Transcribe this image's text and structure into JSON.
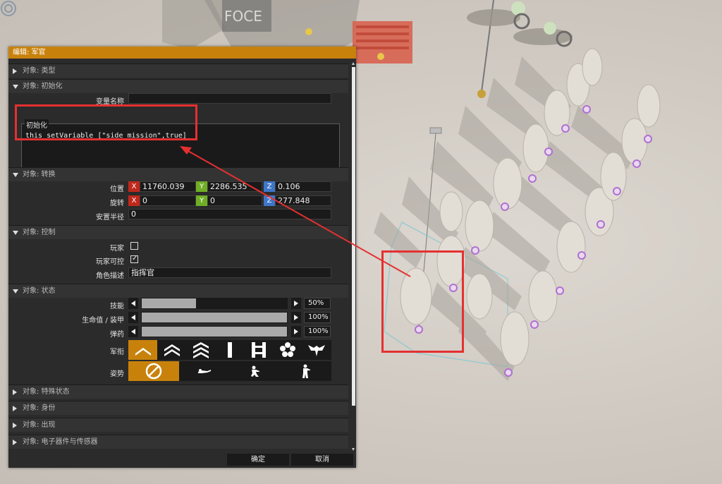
{
  "dialog": {
    "title": "编辑: 军官",
    "ok_label": "确定",
    "cancel_label": "取消"
  },
  "sections": {
    "type": "对象: 类型",
    "init": "对象: 初始化",
    "transform": "对象: 转换",
    "control": "对象: 控制",
    "state": "对象: 状态",
    "special": "对象: 特殊状态",
    "identity": "对象: 身份",
    "appearance": "对象: 出现",
    "electronics": "对象: 电子器件与传感器"
  },
  "init": {
    "var_name_label": "变量名称",
    "var_name_value": "",
    "init_label": "初始化",
    "init_code": "this setVariable [\"side_mission\",true]"
  },
  "transform": {
    "position_label": "位置",
    "rotation_label": "旋转",
    "radius_label": "安置半径",
    "axis_x": "X",
    "axis_y": "Y",
    "axis_z": "Z",
    "pos_x": "11760.039",
    "pos_y": "2286.535",
    "pos_z": "0.106",
    "rot_x": "0",
    "rot_y": "0",
    "rot_z": "277.848",
    "radius": "0"
  },
  "control": {
    "player_label": "玩家",
    "player_checked": false,
    "playable_label": "玩家可控",
    "playable_checked": true,
    "role_label": "角色描述",
    "role_value": "指挥官"
  },
  "state": {
    "skill_label": "技能",
    "skill_value": "50%",
    "skill_fraction": 0.5,
    "health_label": "生命值 / 装甲",
    "health_value": "100%",
    "health_fraction": 1.0,
    "ammo_label": "弹药",
    "ammo_value": "100%",
    "ammo_fraction": 1.0,
    "rank_label": "军衔",
    "ranks": [
      "private-chevron-icon",
      "corporal-icon",
      "sergeant-icon",
      "lieutenant-icon",
      "captain-icon",
      "major-icon",
      "colonel-icon"
    ],
    "rank_selected": 0,
    "stance_label": "姿势",
    "stances": [
      "no-stance-icon",
      "prone-icon",
      "crouch-icon",
      "stand-icon"
    ],
    "stance_selected": 0
  },
  "colors": {
    "accent": "#c8820c",
    "annotation": "#e53030",
    "axis_x": "#c0281c",
    "axis_y": "#6fae26",
    "axis_z": "#3e76c8"
  }
}
